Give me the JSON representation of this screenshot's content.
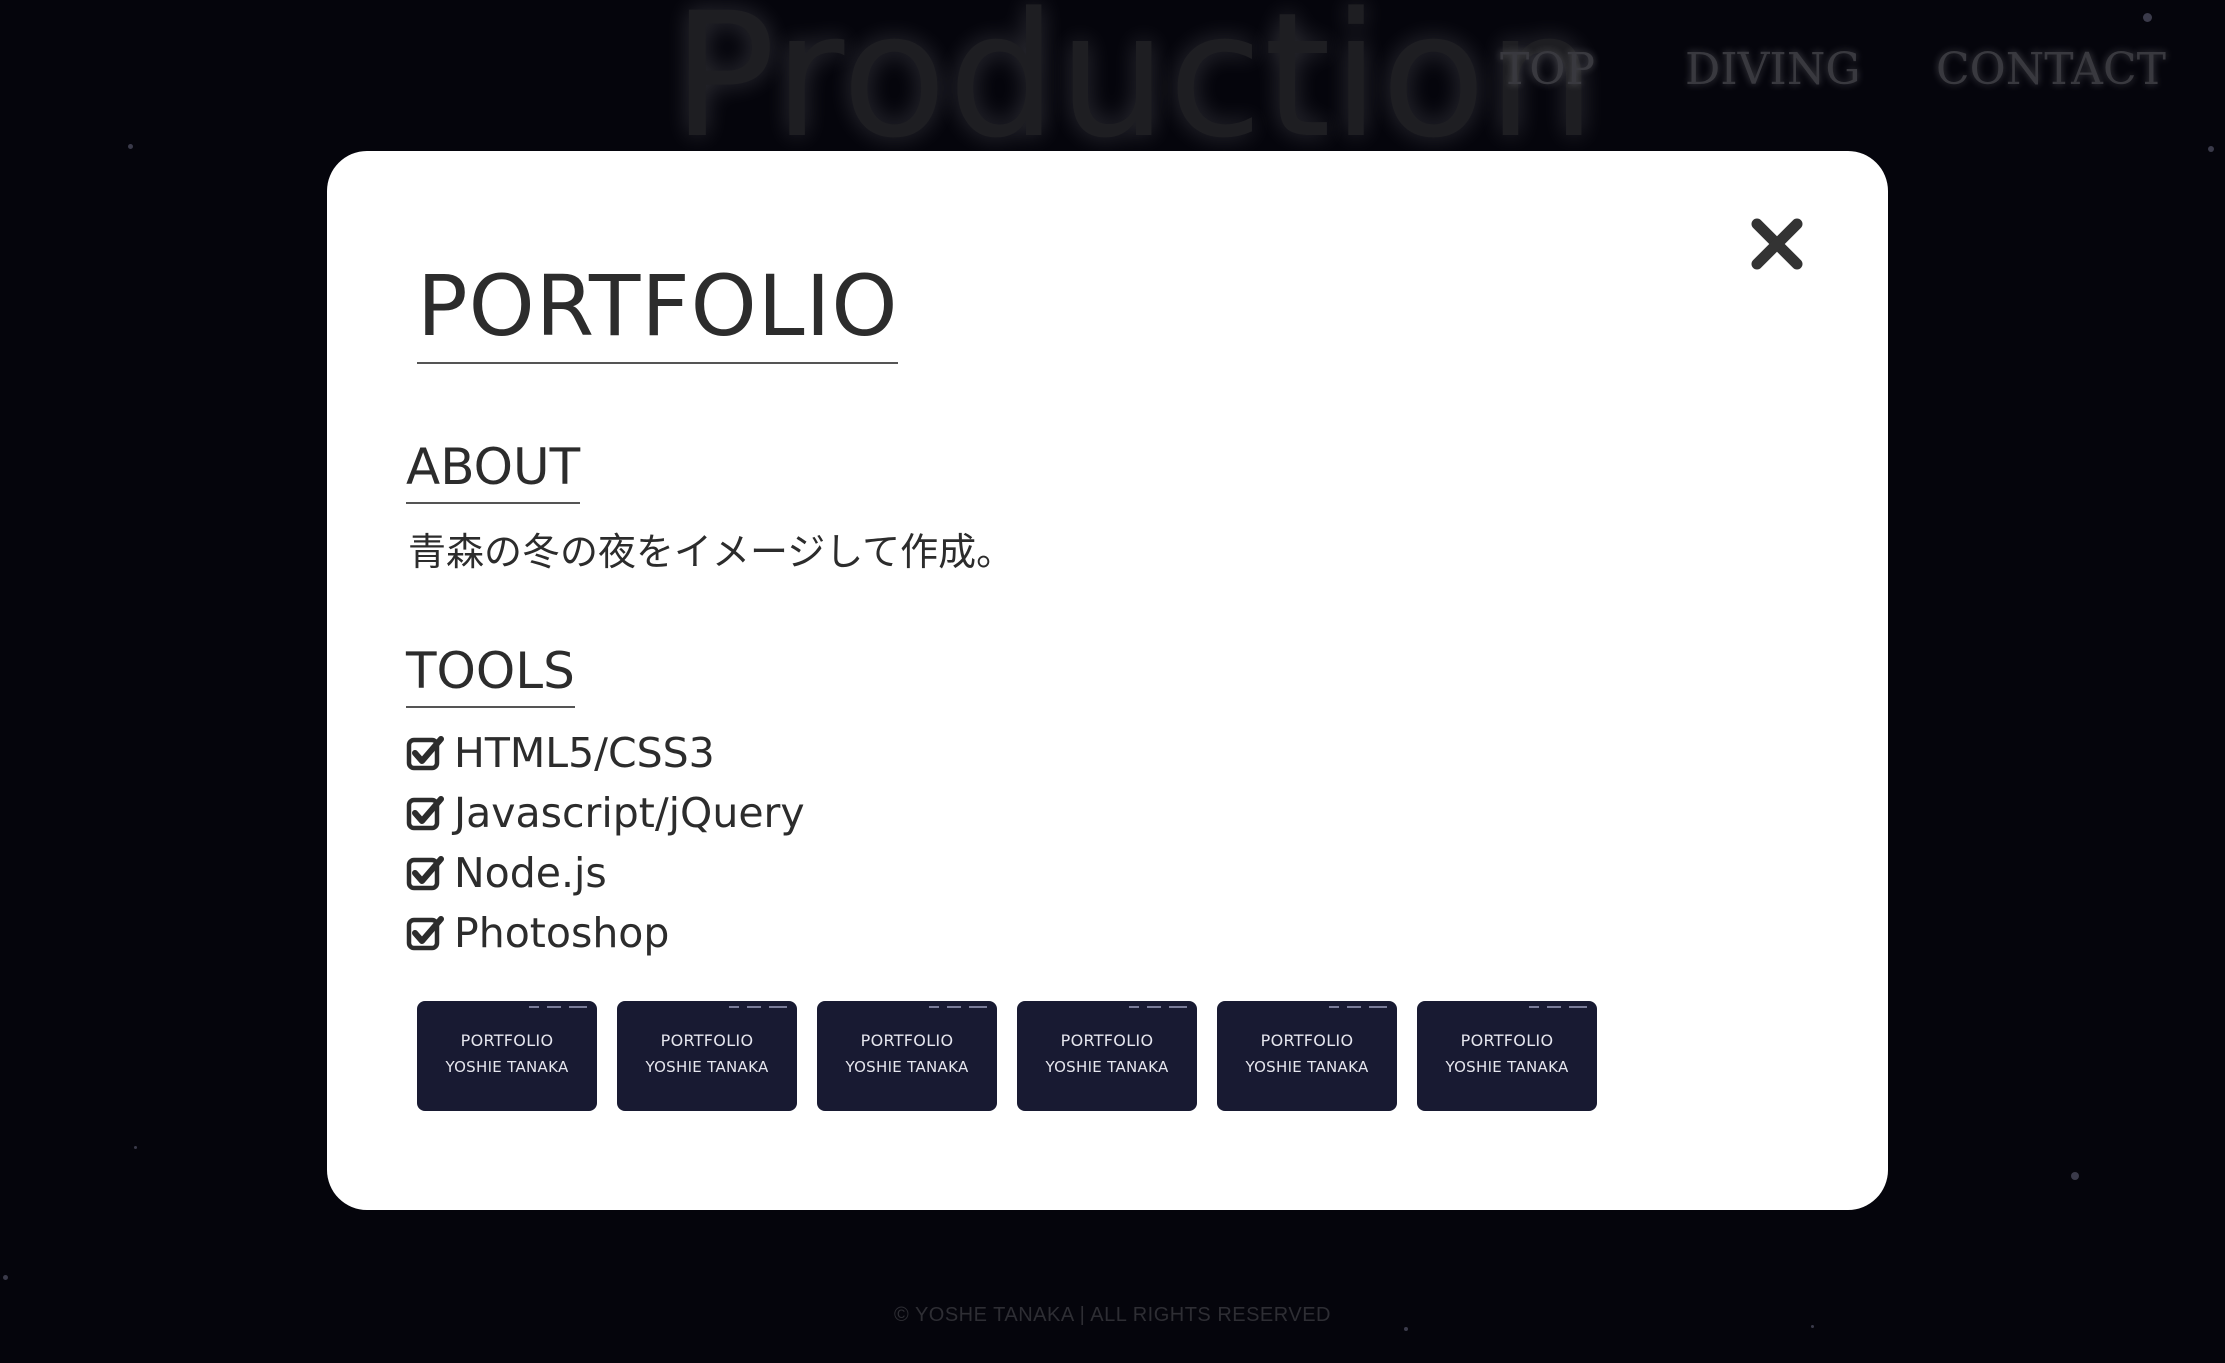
{
  "background": {
    "title": "Production"
  },
  "nav": {
    "items": [
      {
        "label": "TOP"
      },
      {
        "label": "DIVING"
      },
      {
        "label": "CONTACT"
      }
    ]
  },
  "modal": {
    "title": "PORTFOLIO",
    "close_icon": "close-icon",
    "about": {
      "heading": "ABOUT",
      "text": "青森の冬の夜をイメージして作成。"
    },
    "tools": {
      "heading": "TOOLS",
      "items": [
        {
          "label": "HTML5/CSS3",
          "icon": "check-square-icon"
        },
        {
          "label": "Javascript/jQuery",
          "icon": "check-square-icon"
        },
        {
          "label": "Node.js",
          "icon": "check-square-icon"
        },
        {
          "label": "Photoshop",
          "icon": "check-square-icon"
        }
      ]
    },
    "thumbnails": [
      {
        "line1": "PORTFOLIO",
        "line2": "YOSHIE TANAKA"
      },
      {
        "line1": "PORTFOLIO",
        "line2": "YOSHIE TANAKA"
      },
      {
        "line1": "PORTFOLIO",
        "line2": "YOSHIE TANAKA"
      },
      {
        "line1": "PORTFOLIO",
        "line2": "YOSHIE TANAKA"
      },
      {
        "line1": "PORTFOLIO",
        "line2": "YOSHIE TANAKA"
      },
      {
        "line1": "PORTFOLIO",
        "line2": "YOSHIE TANAKA"
      }
    ]
  },
  "footer": {
    "copyright": "© YOSHE TANAKA | ALL RIGHTS RESERVED"
  },
  "colors": {
    "page_background": "#05050c",
    "modal_background": "#ffffff",
    "text": "#2c2c2c",
    "thumbnail_background": "#181a32"
  }
}
